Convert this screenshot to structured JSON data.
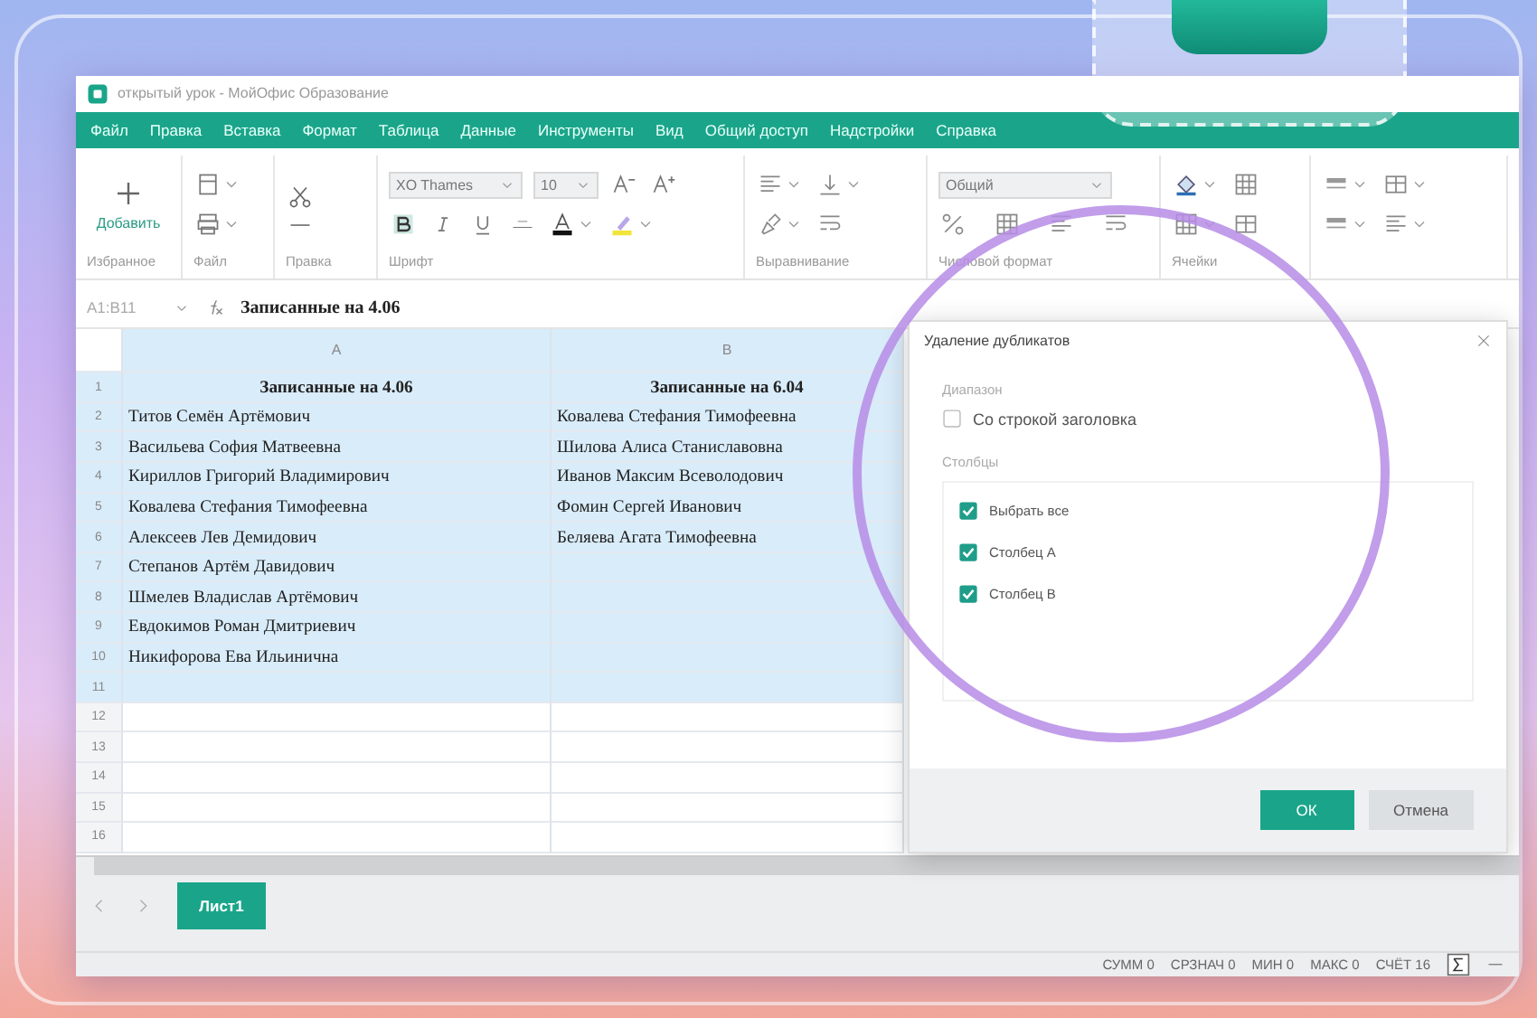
{
  "window": {
    "title": "открытый урок - МойОфис Образование"
  },
  "menu": [
    "Файл",
    "Правка",
    "Вставка",
    "Формат",
    "Таблица",
    "Данные",
    "Инструменты",
    "Вид",
    "Общий доступ",
    "Надстройки",
    "Справка"
  ],
  "ribbon": {
    "add_button": "Добавить",
    "font_name": "XO Thames",
    "font_size": "10",
    "number_format": "Общий",
    "groups": [
      "Избранное",
      "Файл",
      "Правка",
      "Шрифт",
      "Выравнивание",
      "Числовой формат",
      "Ячейки"
    ]
  },
  "formula_bar": {
    "cell_ref": "A1:B11",
    "content": "Записанные на 4.06"
  },
  "sheet": {
    "columns": [
      {
        "label": "A",
        "selected": true
      },
      {
        "label": "B",
        "selected": true
      }
    ],
    "rows": [
      {
        "number": "1",
        "selected": true,
        "kind": "header",
        "cells": [
          "Записанные на 4.06",
          "Записанные  на 6.04"
        ]
      },
      {
        "number": "2",
        "selected": true,
        "kind": "data",
        "cells": [
          "Титов Семён Артёмович",
          "Ковалева Стефания Тимофеевна"
        ]
      },
      {
        "number": "3",
        "selected": true,
        "kind": "data",
        "cells": [
          "Васильева София Матвеевна",
          "Шилова Алиса Станиславовна"
        ]
      },
      {
        "number": "4",
        "selected": true,
        "kind": "data",
        "cells": [
          "Кириллов Григорий Владимирович",
          "Иванов Максим Всеволодович"
        ]
      },
      {
        "number": "5",
        "selected": true,
        "kind": "data",
        "cells": [
          "Ковалева Стефания Тимофеевна",
          "Фомин Сергей Иванович"
        ]
      },
      {
        "number": "6",
        "selected": true,
        "kind": "data",
        "cells": [
          "Алексеев Лев Демидович",
          "Беляева Агата Тимофеевна"
        ]
      },
      {
        "number": "7",
        "selected": true,
        "kind": "data",
        "cells": [
          "Степанов Артём Давидович"
        ]
      },
      {
        "number": "8",
        "selected": true,
        "kind": "data",
        "cells": [
          "Шмелев Владислав Артёмович"
        ]
      },
      {
        "number": "9",
        "selected": true,
        "kind": "data",
        "cells": [
          "Евдокимов Роман Дмитриевич"
        ]
      },
      {
        "number": "10",
        "selected": true,
        "kind": "data",
        "cells": [
          "Никифорова Ева Ильинична"
        ]
      },
      {
        "number": "11",
        "selected": true,
        "kind": "data",
        "cells": []
      },
      {
        "number": "12",
        "selected": false,
        "kind": "data",
        "cells": []
      },
      {
        "number": "13",
        "selected": false,
        "kind": "data",
        "cells": []
      },
      {
        "number": "14",
        "selected": false,
        "kind": "data",
        "cells": []
      },
      {
        "number": "15",
        "selected": false,
        "kind": "data",
        "cells": []
      },
      {
        "number": "16",
        "selected": false,
        "kind": "data",
        "cells": []
      }
    ]
  },
  "dialog": {
    "title": "Удаление дубликатов",
    "range_label": "Диапазон",
    "header_option": {
      "label": "Со строкой заголовка",
      "checked": false
    },
    "columns_label": "Столбцы",
    "columns": [
      {
        "label": "Выбрать все",
        "checked": true
      },
      {
        "label": "Столбец A",
        "checked": true
      },
      {
        "label": "Столбец B",
        "checked": true
      }
    ],
    "buttons": [
      {
        "label": "ОК",
        "kind": "primary"
      },
      {
        "label": "Отмена",
        "kind": "secondary"
      }
    ]
  },
  "sheet_tabs": [
    {
      "label": "Лист1",
      "selected": true
    }
  ],
  "status_bar": [
    {
      "label": "СУММ",
      "value": "0"
    },
    {
      "label": "СРЗНАЧ",
      "value": "0"
    },
    {
      "label": "МИН",
      "value": "0"
    },
    {
      "label": "МАКС",
      "value": "0"
    },
    {
      "label": "СЧЁТ",
      "value": "16"
    }
  ]
}
